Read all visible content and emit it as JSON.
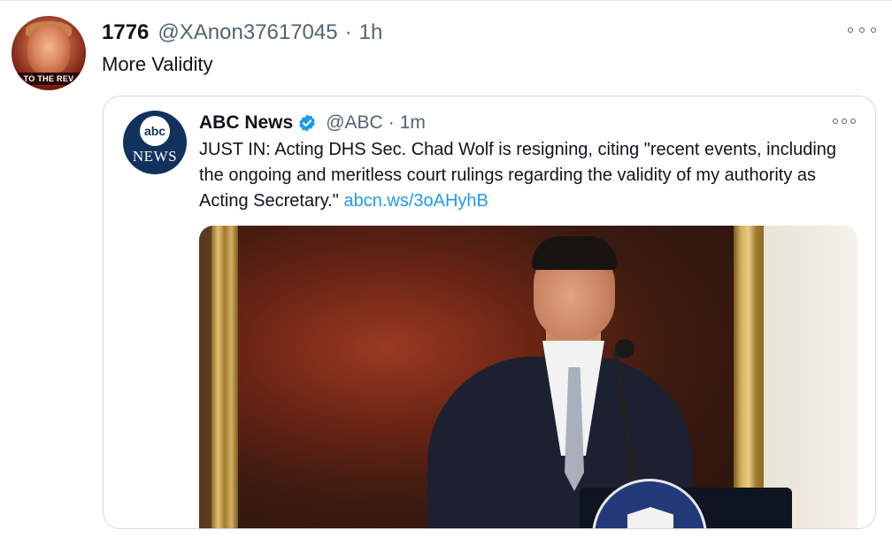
{
  "tweet": {
    "display_name": "1776",
    "handle": "@XAnon37617045",
    "separator": "·",
    "time": "1h",
    "text": "More Validity",
    "avatar_banner": "TO THE REV"
  },
  "quoted": {
    "display_name": "ABC News",
    "handle": "@ABC",
    "separator": "·",
    "time": "1m",
    "text": "JUST IN: Acting DHS Sec. Chad Wolf is resigning, citing \"recent events, including the ongoing and meritless court rulings regarding the validity of my authority as Acting Secretary.\"",
    "link": "abcn.ws/3oAHyhB",
    "avatar_logo_top": "abc",
    "avatar_logo_bottom": "NEWS"
  },
  "icons": {
    "more": "more-options-icon",
    "verified": "verified-badge-icon"
  },
  "colors": {
    "link": "#1d9bf0",
    "verified": "#1d9bf0",
    "secondary_text": "#536471",
    "border": "#cfd9de"
  }
}
